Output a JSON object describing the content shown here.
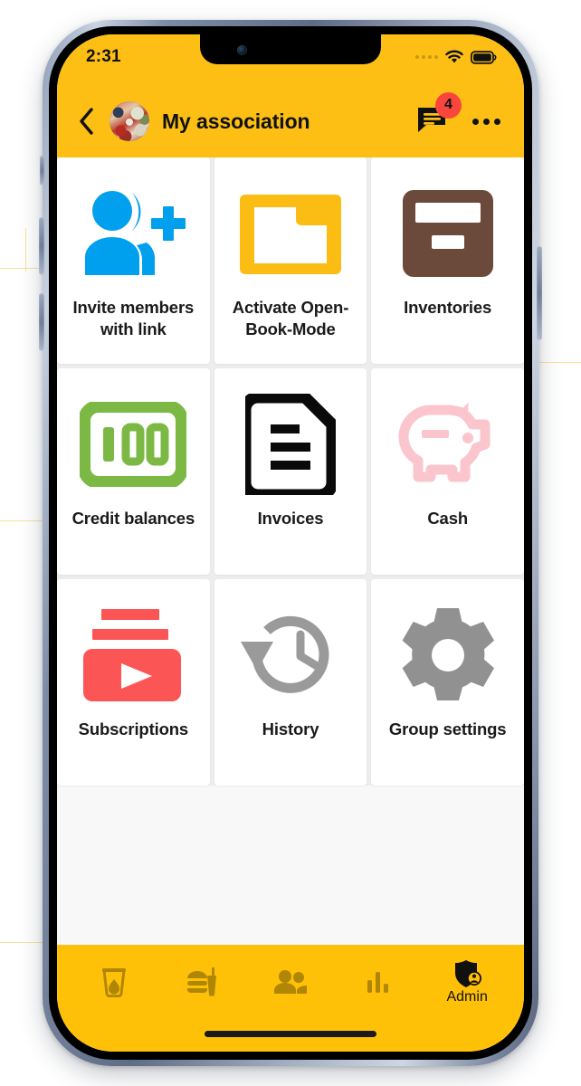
{
  "colors": {
    "header_yellow": "#FDBF14",
    "nav_yellow": "#FFC107",
    "badge_red": "#F9463C",
    "page_bg": "#F8F8F8",
    "tile_bg": "#FFFFFF",
    "invite_blue": "#00A0EE",
    "folder_yellow": "#FBBC14",
    "inventory_brown": "#6B4A3C",
    "credit_green": "#7CB944",
    "invoice_black": "#0A0A0A",
    "cash_pink": "#FBC5CD",
    "subscriptions_red": "#FB5555",
    "history_gray": "#9A9A9A",
    "settings_gray": "#919191",
    "nav_icon_inactive": "#B08605",
    "nav_icon_active": "#111111"
  },
  "status_bar": {
    "time": "2:31",
    "signal_icon": "signal-dots-icon",
    "wifi_icon": "wifi-icon",
    "battery_icon": "battery-full-icon"
  },
  "app_bar": {
    "back_icon": "back-chevron-icon",
    "avatar_icon": "group-avatar-image",
    "title": "My association",
    "chat_icon": "chat-bubble-icon",
    "chat_badge_count": "4",
    "overflow_icon": "overflow-menu-icon"
  },
  "grid": {
    "tiles": [
      {
        "label": "Invite members with link",
        "icon": "person-add-icon"
      },
      {
        "label": "Activate Open-Book-Mode",
        "icon": "folder-icon"
      },
      {
        "label": "Inventories",
        "icon": "archive-box-icon"
      },
      {
        "label": "Credit balances",
        "icon": "banknote-100-icon"
      },
      {
        "label": "Invoices",
        "icon": "document-lines-icon"
      },
      {
        "label": "Cash",
        "icon": "piggy-bank-icon"
      },
      {
        "label": "Subscriptions",
        "icon": "video-subscriptions-icon"
      },
      {
        "label": "History",
        "icon": "clock-rotate-left-icon"
      },
      {
        "label": "Group settings",
        "icon": "gear-icon"
      }
    ]
  },
  "bottom_nav": {
    "items": [
      {
        "label": "",
        "icon": "drink-glass-icon",
        "active": false
      },
      {
        "label": "",
        "icon": "fast-food-icon",
        "active": false
      },
      {
        "label": "",
        "icon": "people-icon",
        "active": false
      },
      {
        "label": "",
        "icon": "bar-chart-icon",
        "active": false
      },
      {
        "label": "Admin",
        "icon": "shield-person-icon",
        "active": true
      }
    ]
  },
  "home_indicator": "home-indicator-bar"
}
